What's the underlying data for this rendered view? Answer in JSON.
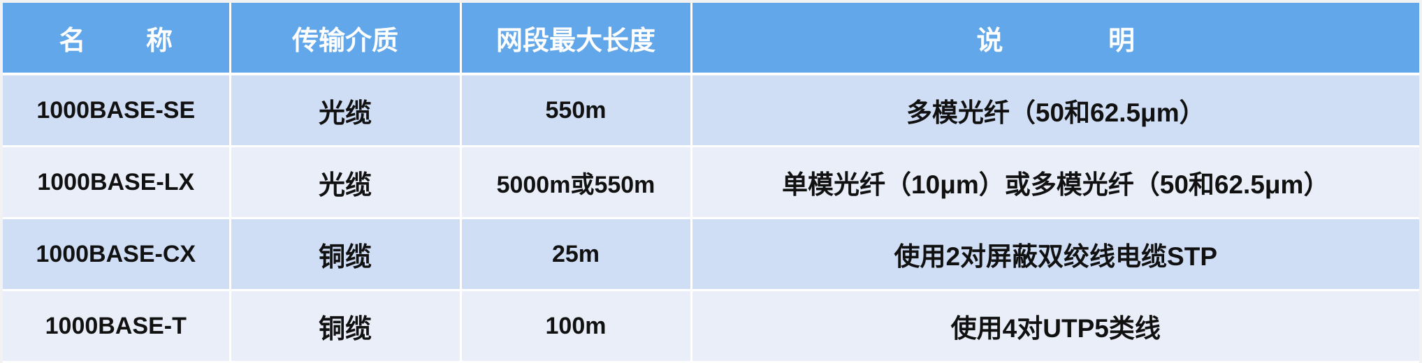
{
  "table": {
    "headers": [
      "名 称",
      "传输介质",
      "网段最大长度",
      "说 明"
    ],
    "rows": [
      {
        "name": "1000BASE-SE",
        "medium": "光缆",
        "max_length": "550m",
        "description": "多模光纤（50和62.5μm）"
      },
      {
        "name": "1000BASE-LX",
        "medium": "光缆",
        "max_length": "5000m或550m",
        "description": "单模光纤（10μm）或多模光纤（50和62.5μm）"
      },
      {
        "name": "1000BASE-CX",
        "medium": "铜缆",
        "max_length": "25m",
        "description": "使用2对屏蔽双绞线电缆STP"
      },
      {
        "name": "1000BASE-T",
        "medium": "铜缆",
        "max_length": "100m",
        "description": "使用4对UTP5类线"
      }
    ]
  },
  "colors": {
    "header_bg": "#62a7ea",
    "row_odd_bg": "#cfddf5",
    "row_even_bg": "#e9eef8"
  }
}
